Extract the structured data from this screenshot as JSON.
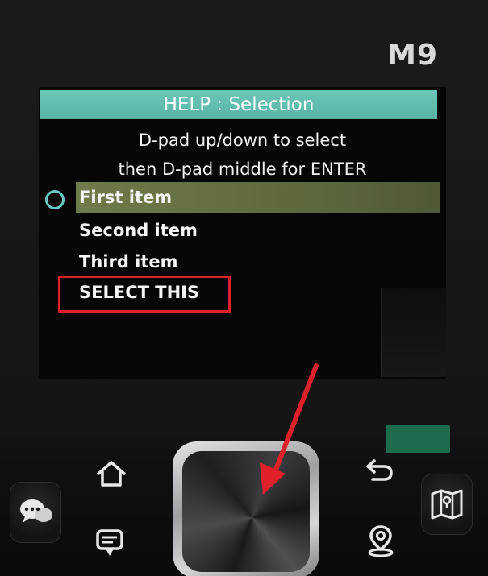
{
  "device": {
    "model_label": "M9"
  },
  "screen": {
    "header_title": "HELP : Selection",
    "instructions": [
      "D-pad up/down to select",
      "then D-pad middle for ENTER"
    ],
    "items": [
      {
        "label": "First item",
        "selected": true
      },
      {
        "label": "Second item",
        "selected": false
      },
      {
        "label": "Third item",
        "selected": false
      },
      {
        "label": "SELECT THIS",
        "selected": false
      }
    ]
  },
  "annotation": {
    "highlight_color": "#e0202a"
  },
  "icons": {
    "home": "home-icon",
    "back": "back-arrow-icon",
    "chat": "chat-bubbles-icon",
    "message": "message-icon",
    "location": "location-pin-icon",
    "map": "map-icon"
  },
  "colors": {
    "header_bg": "#5fbcae",
    "selection_bg": "#66724a",
    "radio": "#6ac7c3"
  }
}
